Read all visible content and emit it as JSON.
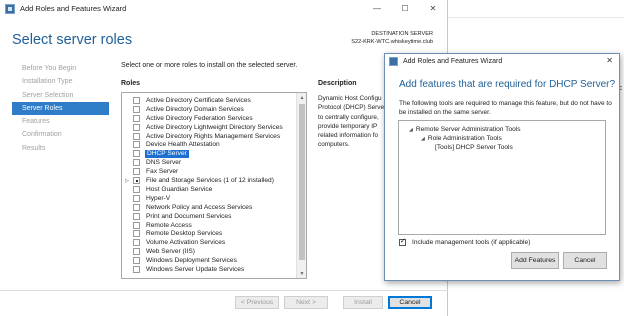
{
  "main": {
    "window_title": "Add Roles and Features Wizard",
    "win_controls": {
      "minimize": "—",
      "maximize": "☐",
      "close": "✕"
    },
    "page_title": "Select server roles",
    "destination_label": "DESTINATION SERVER",
    "destination_server": "S22-KRK-WTC.whiskeytime.club",
    "sidebar": [
      {
        "label": "Before You Begin",
        "active": false
      },
      {
        "label": "Installation Type",
        "active": false
      },
      {
        "label": "Server Selection",
        "active": false
      },
      {
        "label": "Server Roles",
        "active": true
      },
      {
        "label": "Features",
        "active": false
      },
      {
        "label": "Confirmation",
        "active": false
      },
      {
        "label": "Results",
        "active": false
      }
    ],
    "instructions": "Select one or more roles to install on the selected server.",
    "roles_header": "Roles",
    "description_header": "Description",
    "description_lines": [
      "Dynamic Host Configu",
      "Protocol (DHCP) Serve",
      "to centrally configure,",
      "provide temporary IP",
      "related information fo",
      "computers."
    ],
    "roles": [
      {
        "label": "Active Directory Certificate Services",
        "state": "unchecked",
        "expander": ""
      },
      {
        "label": "Active Directory Domain Services",
        "state": "unchecked",
        "expander": ""
      },
      {
        "label": "Active Directory Federation Services",
        "state": "unchecked",
        "expander": ""
      },
      {
        "label": "Active Directory Lightweight Directory Services",
        "state": "unchecked",
        "expander": ""
      },
      {
        "label": "Active Directory Rights Management Services",
        "state": "unchecked",
        "expander": ""
      },
      {
        "label": "Device Health Attestation",
        "state": "unchecked",
        "expander": ""
      },
      {
        "label": "DHCP Server",
        "state": "unchecked",
        "expander": "",
        "selected": true
      },
      {
        "label": "DNS Server",
        "state": "unchecked",
        "expander": ""
      },
      {
        "label": "Fax Server",
        "state": "unchecked",
        "expander": ""
      },
      {
        "label": "File and Storage Services (1 of 12 installed)",
        "state": "partial",
        "expander": "▷"
      },
      {
        "label": "Host Guardian Service",
        "state": "unchecked",
        "expander": ""
      },
      {
        "label": "Hyper-V",
        "state": "unchecked",
        "expander": ""
      },
      {
        "label": "Network Policy and Access Services",
        "state": "unchecked",
        "expander": ""
      },
      {
        "label": "Print and Document Services",
        "state": "unchecked",
        "expander": ""
      },
      {
        "label": "Remote Access",
        "state": "unchecked",
        "expander": ""
      },
      {
        "label": "Remote Desktop Services",
        "state": "unchecked",
        "expander": ""
      },
      {
        "label": "Volume Activation Services",
        "state": "unchecked",
        "expander": ""
      },
      {
        "label": "Web Server (IIS)",
        "state": "unchecked",
        "expander": ""
      },
      {
        "label": "Windows Deployment Services",
        "state": "unchecked",
        "expander": ""
      },
      {
        "label": "Windows Server Update Services",
        "state": "unchecked",
        "expander": ""
      }
    ],
    "buttons": {
      "previous": "< Previous",
      "next": "Next >",
      "install": "Install",
      "cancel": "Cancel"
    }
  },
  "background_window": {
    "fragment_text": "ific"
  },
  "dialog": {
    "window_title": "Add Roles and Features Wizard",
    "close_glyph": "✕",
    "heading": "Add features that are required for DHCP Server?",
    "text": "The following tools are required to manage this feature, but do not have to be installed on the same server.",
    "tree": [
      {
        "label": "Remote Server Administration Tools",
        "level": 0,
        "expander": "◢"
      },
      {
        "label": "Role Administration Tools",
        "level": 1,
        "expander": "◢"
      },
      {
        "label": "[Tools] DHCP Server Tools",
        "level": 2,
        "expander": ""
      }
    ],
    "include_tools_label": "Include management tools (if applicable)",
    "include_tools_checked": true,
    "buttons": {
      "add_features": "Add Features",
      "cancel": "Cancel"
    }
  }
}
